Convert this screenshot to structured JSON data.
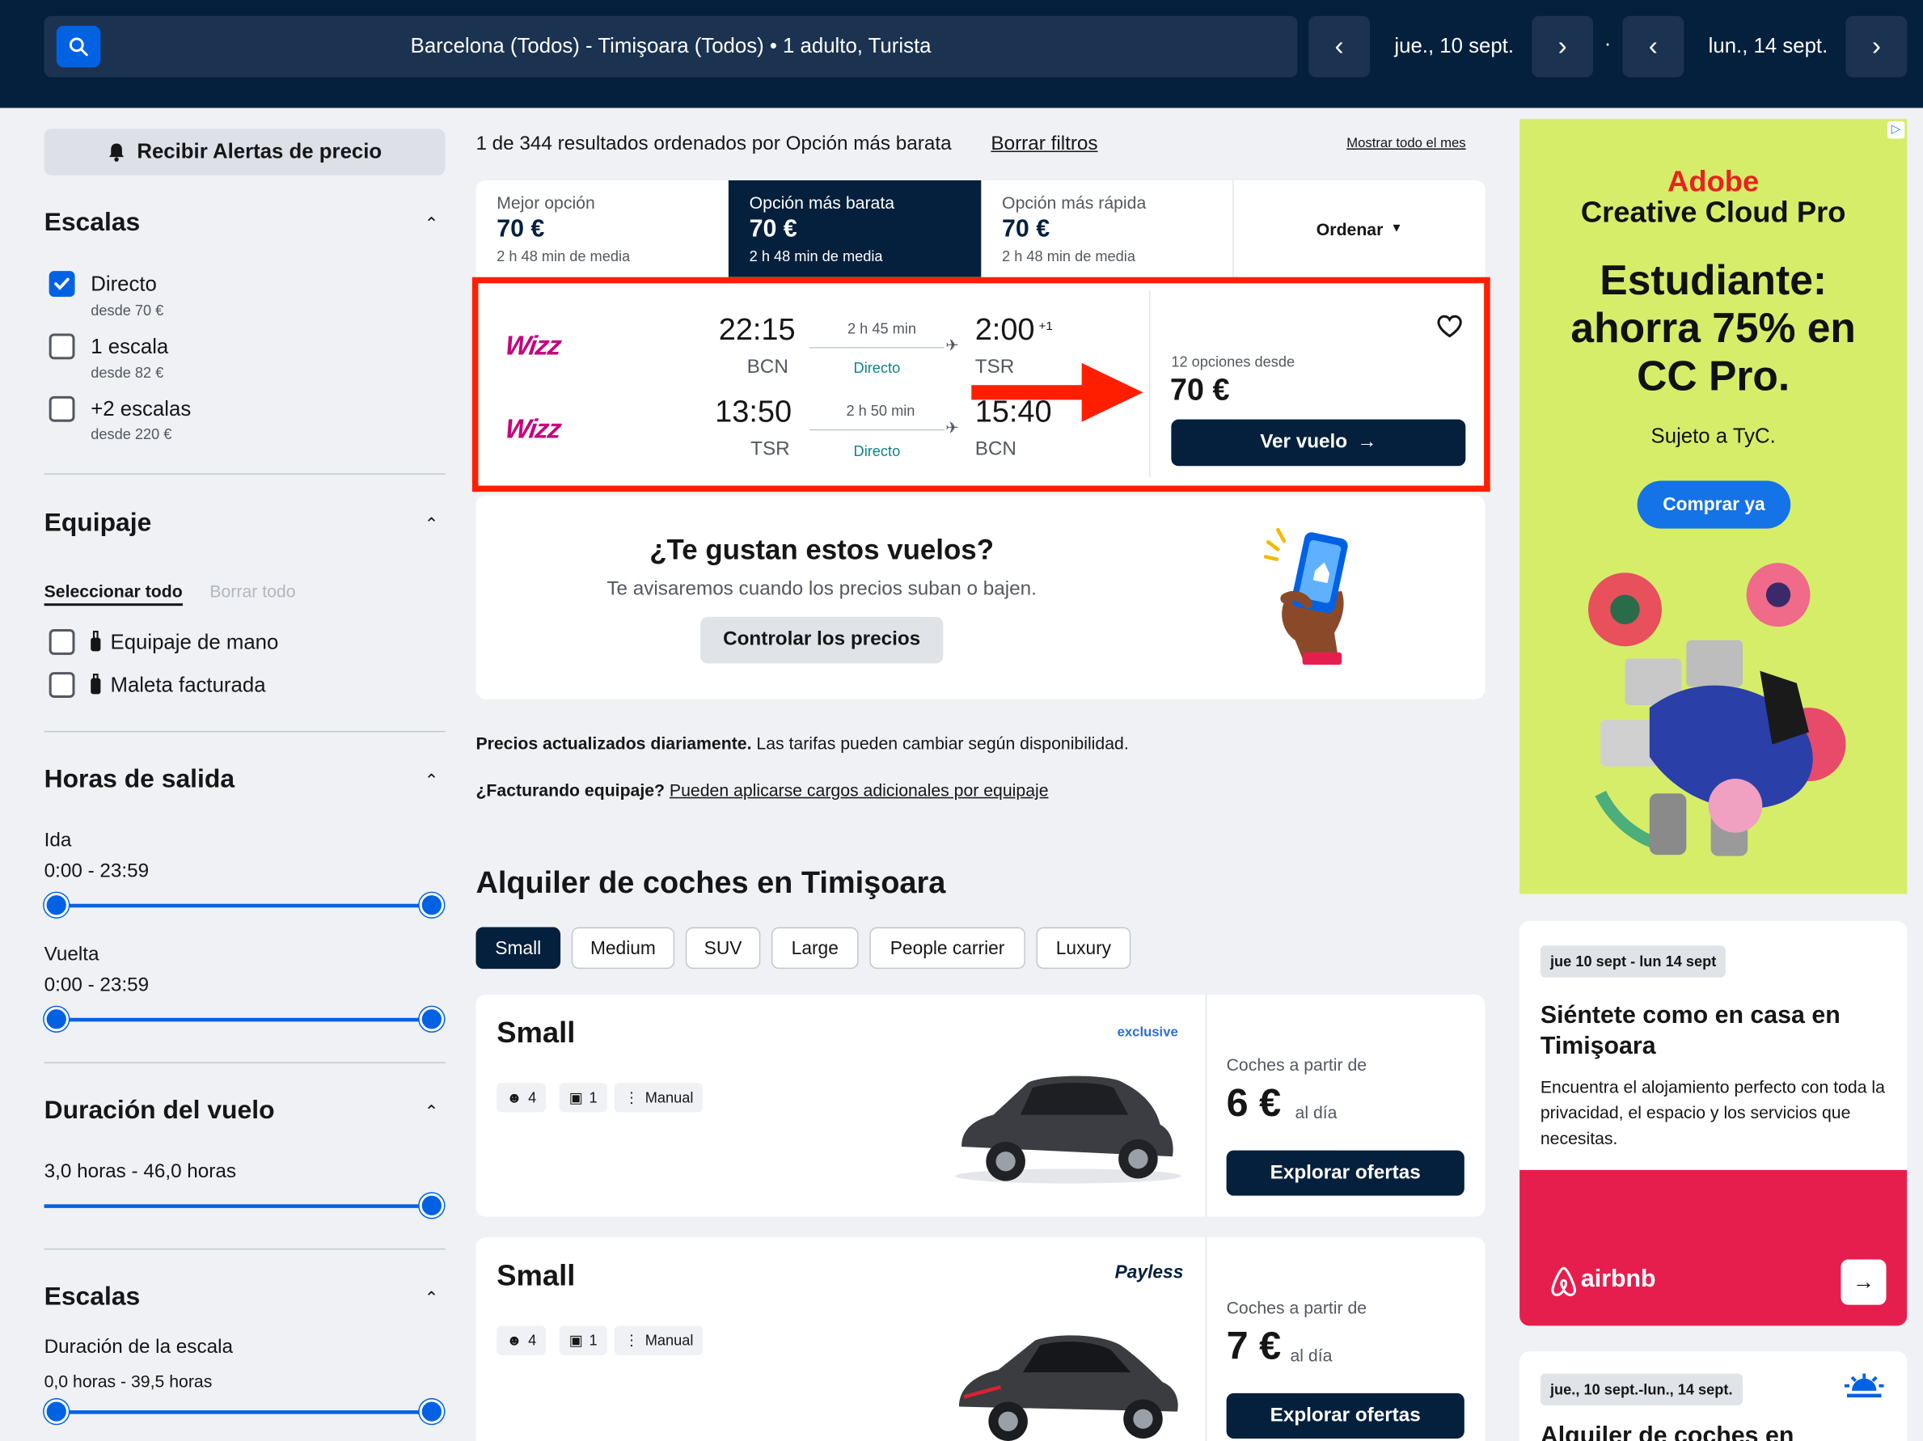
{
  "header": {
    "route": "Barcelona (Todos) - Timişoara (Todos)  •  1 adulto, Turista",
    "date_out": "jue., 10 sept.",
    "date_back": "lun., 14 sept.",
    "separator": "·"
  },
  "sidebar": {
    "alert_button": "Recibir Alertas de precio",
    "stops": {
      "title": "Escalas",
      "options": [
        {
          "label": "Directo",
          "sub": "desde 70 €",
          "checked": true
        },
        {
          "label": "1 escala",
          "sub": "desde 82 €",
          "checked": false
        },
        {
          "label": "+2 escalas",
          "sub": "desde 220 €",
          "checked": false
        }
      ]
    },
    "baggage": {
      "title": "Equipaje",
      "select_all": "Seleccionar todo",
      "clear_all": "Borrar todo",
      "options": [
        "Equipaje de mano",
        "Maleta facturada"
      ]
    },
    "departure": {
      "title": "Horas de salida",
      "out_label": "Ida",
      "out_range": "0:00 - 23:59",
      "back_label": "Vuelta",
      "back_range": "0:00 - 23:59"
    },
    "duration": {
      "title": "Duración del vuelo",
      "range": "3,0 horas - 46,0 horas"
    },
    "layover": {
      "title": "Escalas",
      "label": "Duración de la escala",
      "range": "0,0 horas - 39,5 horas"
    }
  },
  "results": {
    "summary": "1 de 344 resultados ordenados por Opción más barata",
    "clear_filters": "Borrar filtros",
    "show_month": "Mostrar todo el mes",
    "tabs": [
      {
        "label": "Mejor opción",
        "price": "70 €",
        "sub": "2 h 48 min de media"
      },
      {
        "label": "Opción más barata",
        "price": "70 €",
        "sub": "2 h 48 min de media"
      },
      {
        "label": "Opción más rápida",
        "price": "70 €",
        "sub": "2 h 48 min de media"
      }
    ],
    "sort_label": "Ordenar"
  },
  "flight": {
    "airline": "Wizz",
    "outbound": {
      "dep": "22:15",
      "from": "BCN",
      "duration": "2 h 45 min",
      "type": "Directo",
      "arr": "2:00",
      "plus": "+1",
      "to": "TSR"
    },
    "inbound": {
      "dep": "13:50",
      "from": "TSR",
      "duration": "2 h 50 min",
      "type": "Directo",
      "arr": "15:40",
      "to": "BCN"
    },
    "options_from": "12 opciones desde",
    "price": "70 €",
    "cta": "Ver vuelo"
  },
  "promo": {
    "title": "¿Te gustan estos vuelos?",
    "text": "Te avisaremos cuando los precios suban o bajen.",
    "button": "Controlar los precios"
  },
  "notices": {
    "daily_bold": "Precios actualizados diariamente.",
    "daily_text": " Las tarifas pueden cambiar según disponibilidad.",
    "bag_bold": "¿Facturando equipaje?",
    "bag_link": "Pueden aplicarse cargos adicionales por equipaje"
  },
  "cars": {
    "title": "Alquiler de coches en Timişoara",
    "filters": [
      "Small",
      "Medium",
      "SUV",
      "Large",
      "People carrier",
      "Luxury"
    ],
    "items": [
      {
        "class": "Small",
        "brand": "exclusive",
        "seats": "4",
        "bags": "1",
        "transmission": "Manual",
        "from_label": "Coches a partir de",
        "price": "6 €",
        "per": "al día",
        "cta": "Explorar ofertas"
      },
      {
        "class": "Small",
        "brand": "Payless",
        "seats": "4",
        "bags": "1",
        "transmission": "Manual",
        "from_label": "Coches a partir de",
        "price": "7 €",
        "per": "al día",
        "cta": "Explorar ofertas"
      }
    ]
  },
  "ad": {
    "brand": "Adobe",
    "product": "Creative Cloud Pro",
    "headline": "Estudiante: ahorra 75% en CC Pro.",
    "terms": "Sujeto a TyC.",
    "cta": "Comprar ya"
  },
  "airbnb": {
    "tag": "jue 10 sept - lun 14 sept",
    "title": "Siéntete como en casa en Timişoara",
    "text": "Encuentra el alojamiento perfecto con toda la privacidad, el espacio y los servicios que necesitas.",
    "brand": "airbnb"
  },
  "car_card": {
    "tag": "jue., 10 sept.-lun., 14 sept.",
    "title": "Alquiler de coches en"
  },
  "colors": {
    "navy": "#05203c",
    "blue": "#0062e3",
    "red": "#ff1f00",
    "airbnb": "#e61e4d",
    "ad_bg": "#d6ed6a"
  }
}
